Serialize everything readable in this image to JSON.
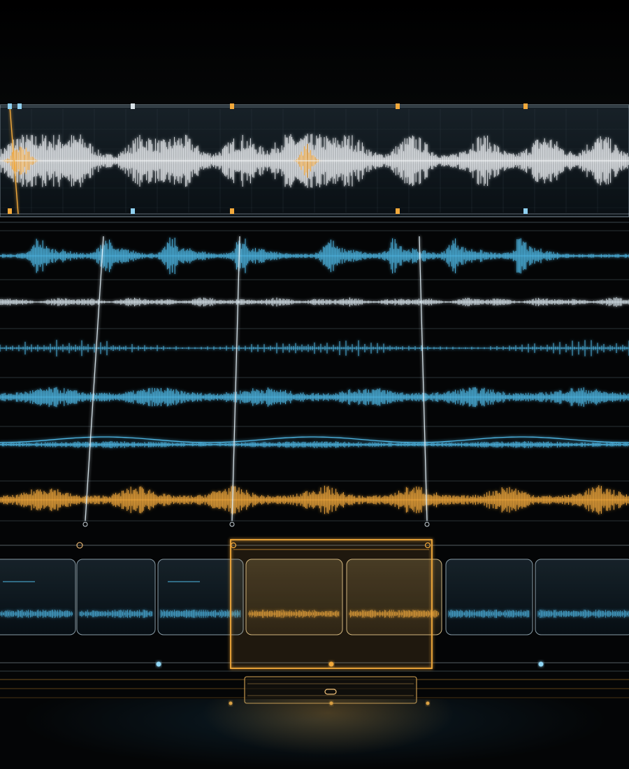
{
  "colors": {
    "background": "#040506",
    "master_wave": "#e8ecef",
    "cyan_wave": "#4fb8e6",
    "amber_wave": "#f2a93b",
    "grid_line": "#3a4650",
    "panel_fill": "#0b1218"
  },
  "master_track": {
    "markers": [
      {
        "color": "amber",
        "handle": "bottom"
      },
      {
        "color": "white",
        "handle": "top"
      },
      {
        "color": "amber",
        "handle": "top"
      },
      {
        "color": "amber",
        "handle": "top"
      },
      {
        "color": "amber",
        "handle": "top"
      }
    ]
  },
  "stems": [
    {
      "kind": "transient-cyan"
    },
    {
      "kind": "dense-white"
    },
    {
      "kind": "pulse-cyan"
    },
    {
      "kind": "texture-cyan"
    },
    {
      "kind": "swell-cyan"
    },
    {
      "kind": "texture-amber"
    }
  ],
  "clips": {
    "count": 7,
    "selected_indices": [
      3,
      4
    ]
  },
  "icons": {
    "playhead_handle": "circle-handle-icon",
    "transport_handle": "pill-handle-icon"
  }
}
